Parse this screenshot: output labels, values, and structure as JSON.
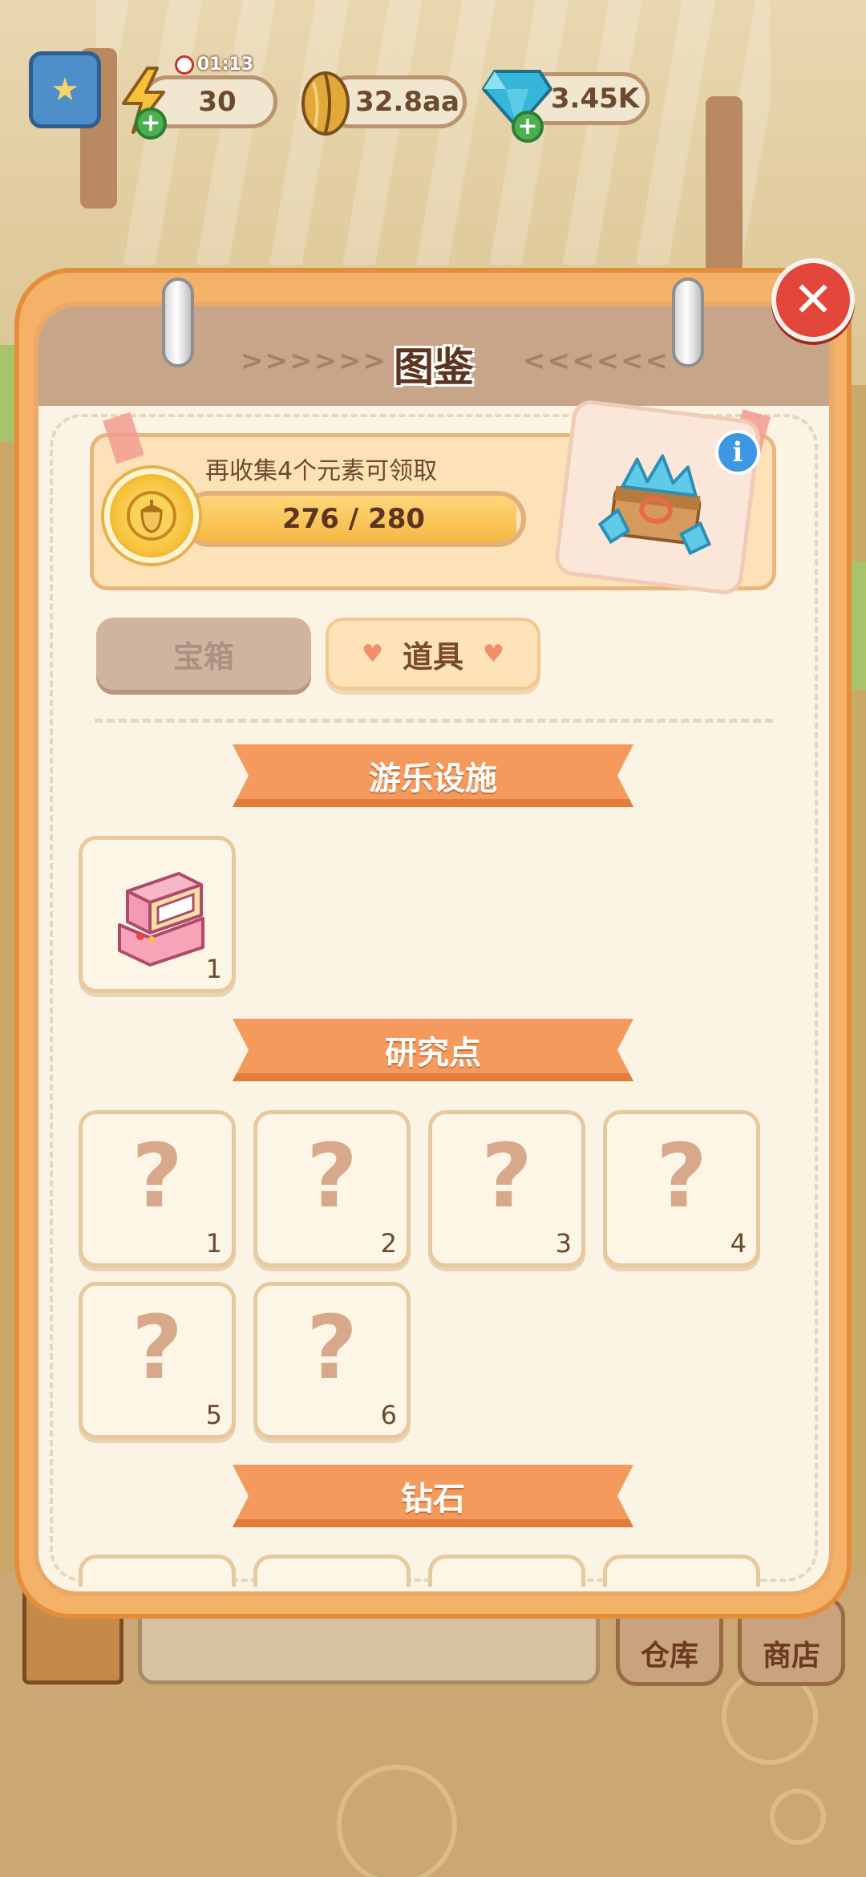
{
  "hud": {
    "energy_timer": "01:13",
    "energy_value": "30",
    "seeds_value": "32.8aa",
    "gems_value": "3.45K"
  },
  "panel": {
    "title": "图鉴",
    "arrows_left": ">>>>>>",
    "arrows_right": "<<<<<<",
    "close_icon": "close-icon"
  },
  "progress": {
    "label": "再收集4个元素可领取",
    "current": 276,
    "total": 280,
    "text": "276 / 280"
  },
  "tabs": {
    "chest_label": "宝箱",
    "items_label": "道具"
  },
  "sections": [
    {
      "title": "游乐设施",
      "items": [
        {
          "icon": "arcade-machine-icon",
          "number": "1"
        }
      ]
    },
    {
      "title": "研究点",
      "items": [
        {
          "icon": "question-mark",
          "number": "1"
        },
        {
          "icon": "question-mark",
          "number": "2"
        },
        {
          "icon": "question-mark",
          "number": "3"
        },
        {
          "icon": "question-mark",
          "number": "4"
        },
        {
          "icon": "question-mark",
          "number": "5"
        },
        {
          "icon": "question-mark",
          "number": "6"
        }
      ]
    },
    {
      "title": "钻石",
      "items": []
    }
  ],
  "unknown_glyph": "?",
  "bottom_nav": {
    "warehouse_label": "仓库",
    "shop_label": "商店"
  },
  "colors": {
    "panel_orange": "#f4b268",
    "ribbon": "#f59a5d",
    "progress_fill": "#f4b843",
    "close_red": "#e2453a"
  }
}
